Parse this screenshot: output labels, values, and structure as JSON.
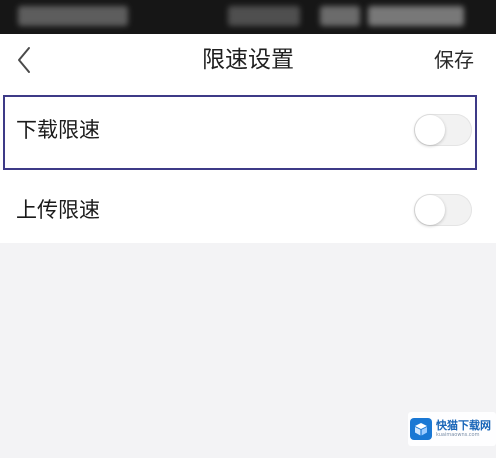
{
  "status_bar": {},
  "header": {
    "title": "限速设置",
    "save_label": "保存",
    "back_icon": "chevron-left-icon"
  },
  "settings": {
    "items": [
      {
        "label": "下载限速",
        "enabled": false,
        "selected": true
      },
      {
        "label": "上传限速",
        "enabled": false,
        "selected": false
      }
    ]
  },
  "watermark": {
    "name": "快猫下载网",
    "url": "kuaimaowns.com"
  },
  "colors": {
    "background": "#f3f3f5",
    "status_bar": "#161616",
    "selection_border": "#3e3a87",
    "toggle_off": "#f2f2f2"
  }
}
